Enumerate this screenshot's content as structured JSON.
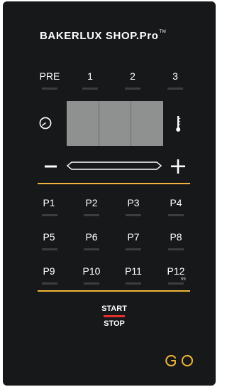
{
  "brand": {
    "name": "BAKERLUX SHOP.Pro",
    "trademark": "TM"
  },
  "stages": [
    "PRE",
    "1",
    "2",
    "3"
  ],
  "programs": [
    "P1",
    "P2",
    "P3",
    "P4",
    "P5",
    "P6",
    "P7",
    "P8",
    "P9",
    "P10",
    "P11",
    "P12"
  ],
  "program_subscript": "99",
  "controls": {
    "start_label": "START",
    "stop_label": "STOP"
  },
  "colors": {
    "panel": "#17181a",
    "accent_gold": "#f0b43a",
    "stop_red": "#e0312f",
    "display": "#8f9190"
  },
  "icons": {
    "timer": "clock-icon",
    "temperature": "thermometer-icon",
    "decrease": "minus-icon",
    "increase": "plus-icon",
    "logo": "go-logo-icon"
  }
}
